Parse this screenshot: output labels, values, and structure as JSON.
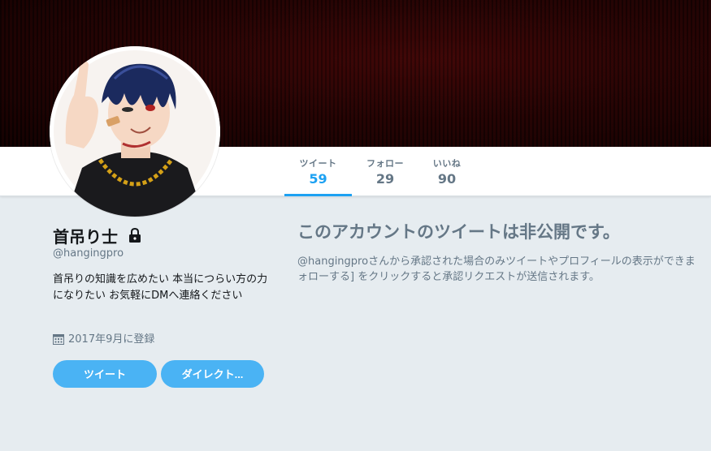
{
  "profile": {
    "name": "首吊り士",
    "handle": "@hangingpro",
    "bio": "首吊りの知識を広めたい 本当につらい方の力になりたい お気軽にDMへ連絡ください",
    "joined": "2017年9月に登録",
    "avatar_icon": "profile-avatar",
    "protected_icon": "lock-icon"
  },
  "stats": [
    {
      "label": "ツイート",
      "value": "59",
      "active": true
    },
    {
      "label": "フォロー",
      "value": "29",
      "active": false
    },
    {
      "label": "いいね",
      "value": "90",
      "active": false
    }
  ],
  "buttons": {
    "tweet": "ツイート",
    "direct": "ダイレクト..."
  },
  "protected": {
    "title": "このアカウントのツイートは非公開です。",
    "line1": "@hangingproさんから承認された場合のみツイートやプロフィールの表示ができま",
    "line2": "ォローする] をクリックすると承認リクエストが送信されます。"
  },
  "colors": {
    "accent": "#1da1f2",
    "button": "#4ab3f4",
    "muted": "#657786",
    "background": "#e6ecf0",
    "banner": "#140303"
  }
}
